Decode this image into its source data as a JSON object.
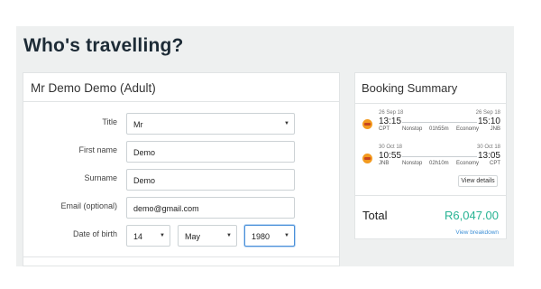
{
  "page": {
    "title": "Who's travelling?"
  },
  "passenger_form": {
    "header": "Mr Demo Demo (Adult)",
    "fields": {
      "title": {
        "label": "Title",
        "value": "Mr"
      },
      "first_name": {
        "label": "First name",
        "value": "Demo"
      },
      "surname": {
        "label": "Surname",
        "value": "Demo"
      },
      "email": {
        "label": "Email (optional)",
        "value": "demo@gmail.com"
      },
      "dob": {
        "label": "Date of birth",
        "day": "14",
        "month": "May",
        "year": "1980"
      }
    }
  },
  "booking_summary": {
    "title": "Booking Summary",
    "flights": [
      {
        "dep_date": "26 Sep 18",
        "dep_time": "13:15",
        "dep_code": "CPT",
        "arr_date": "26 Sep 18",
        "arr_time": "15:10",
        "arr_code": "JNB",
        "stops": "Nonstop",
        "duration": "01h55m",
        "cabin": "Economy"
      },
      {
        "dep_date": "30 Oct 18",
        "dep_time": "10:55",
        "dep_code": "JNB",
        "arr_date": "30 Oct 18",
        "arr_time": "13:05",
        "arr_code": "CPT",
        "stops": "Nonstop",
        "duration": "02h10m",
        "cabin": "Economy"
      }
    ],
    "details_button": "View details",
    "total_label": "Total",
    "total_value": "R6,047.00",
    "breakdown_link": "View breakdown"
  },
  "colors": {
    "accent_green": "#27b393",
    "link_blue": "#3d8fd6",
    "title_dark": "#1d2b36",
    "airline_orange": "#f39a1f"
  },
  "icons": {
    "airline": "airline-logo-icon",
    "select_caret": "caret-down-icon"
  }
}
